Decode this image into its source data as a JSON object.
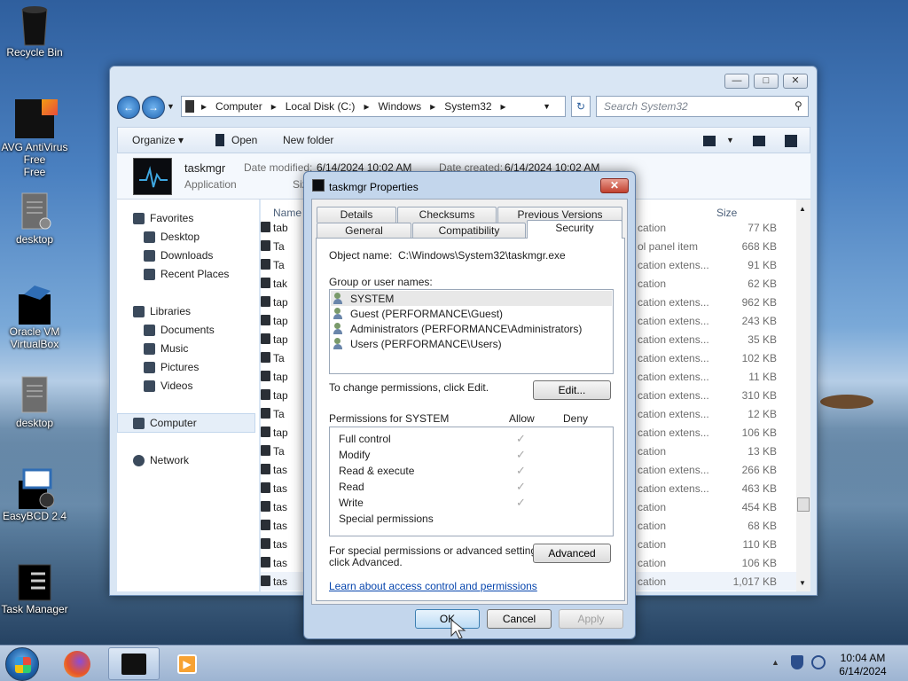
{
  "desktop": {
    "icons": [
      {
        "label": "Recycle Bin",
        "icon": "recycle-bin-icon"
      },
      {
        "label": "AVG AntiVirus Free",
        "icon": "avg-icon"
      },
      {
        "label": "desktop",
        "icon": "file-icon"
      },
      {
        "label": "Oracle VM VirtualBox",
        "icon": "virtualbox-icon"
      },
      {
        "label": "desktop",
        "icon": "file-icon"
      },
      {
        "label": "EasyBCD 2.4",
        "icon": "easybcd-icon"
      },
      {
        "label": "Task Manager",
        "icon": "task-manager-icon"
      }
    ]
  },
  "explorer": {
    "address": [
      "Computer",
      "Local Disk (C:)",
      "Windows",
      "System32"
    ],
    "search_placeholder": "Search System32",
    "toolbar": {
      "organize": "Organize",
      "open": "Open",
      "new_folder": "New folder"
    },
    "details": {
      "name": "taskmgr",
      "type": "Application",
      "modified_label": "Date modified:",
      "modified": "6/14/2024 10:02 AM",
      "created_label": "Date created:",
      "created": "6/14/2024 10:02 AM",
      "size_label": "Siz"
    },
    "nav": {
      "favorites": "Favorites",
      "desktop": "Desktop",
      "downloads": "Downloads",
      "recent": "Recent Places",
      "libraries": "Libraries",
      "documents": "Documents",
      "music": "Music",
      "pictures": "Pictures",
      "videos": "Videos",
      "computer": "Computer",
      "network": "Network"
    },
    "columns": {
      "name": "Name",
      "size": "Size"
    },
    "files": [
      {
        "name": "tab",
        "type": "cation",
        "size": "77 KB"
      },
      {
        "name": "Ta",
        "type": "ol panel item",
        "size": "668 KB"
      },
      {
        "name": "Ta",
        "type": "cation extens...",
        "size": "91 KB"
      },
      {
        "name": "tak",
        "type": "cation",
        "size": "62 KB"
      },
      {
        "name": "tap",
        "type": "cation extens...",
        "size": "962 KB"
      },
      {
        "name": "tap",
        "type": "cation extens...",
        "size": "243 KB"
      },
      {
        "name": "tap",
        "type": "cation extens...",
        "size": "35 KB"
      },
      {
        "name": "Ta",
        "type": "cation extens...",
        "size": "102 KB"
      },
      {
        "name": "tap",
        "type": "cation extens...",
        "size": "11 KB"
      },
      {
        "name": "tap",
        "type": "cation extens...",
        "size": "310 KB"
      },
      {
        "name": "Ta",
        "type": "cation extens...",
        "size": "12 KB"
      },
      {
        "name": "tap",
        "type": "cation extens...",
        "size": "106 KB"
      },
      {
        "name": "Ta",
        "type": "cation",
        "size": "13 KB"
      },
      {
        "name": "tas",
        "type": "cation extens...",
        "size": "266 KB"
      },
      {
        "name": "tas",
        "type": "cation extens...",
        "size": "463 KB"
      },
      {
        "name": "tas",
        "type": "cation",
        "size": "454 KB"
      },
      {
        "name": "tas",
        "type": "cation",
        "size": "68 KB"
      },
      {
        "name": "tas",
        "type": "cation",
        "size": "110 KB"
      },
      {
        "name": "tas",
        "type": "cation",
        "size": "106 KB"
      },
      {
        "name": "tas",
        "type": "cation",
        "size": "1,017 KB"
      }
    ]
  },
  "dialog": {
    "title": "taskmgr Properties",
    "close": "✕",
    "tabs_top": [
      "Details",
      "Checksums",
      "Previous Versions"
    ],
    "tabs_bottom": [
      "General",
      "Compatibility",
      "Security"
    ],
    "object_label": "Object name:",
    "object_value": "C:\\Windows\\System32\\taskmgr.exe",
    "group_label": "Group or user names:",
    "users": [
      "SYSTEM",
      "Guest (PERFORMANCE\\Guest)",
      "Administrators (PERFORMANCE\\Administrators)",
      "Users (PERFORMANCE\\Users)"
    ],
    "change_text": "To change permissions, click Edit.",
    "edit_button": "Edit...",
    "perm_label": "Permissions for SYSTEM",
    "allow": "Allow",
    "deny": "Deny",
    "permissions": [
      {
        "name": "Full control",
        "allow": "✓"
      },
      {
        "name": "Modify",
        "allow": "✓"
      },
      {
        "name": "Read & execute",
        "allow": "✓"
      },
      {
        "name": "Read",
        "allow": "✓"
      },
      {
        "name": "Write",
        "allow": "✓"
      },
      {
        "name": "Special permissions",
        "allow": ""
      }
    ],
    "special_text_1": "For special permissions or advanced settings,",
    "special_text_2": "click Advanced.",
    "advanced_button": "Advanced",
    "learn_link": "Learn about access control and permissions",
    "ok": "OK",
    "cancel": "Cancel",
    "apply": "Apply"
  },
  "taskbar": {
    "time": "10:04 AM",
    "date": "6/14/2024"
  }
}
